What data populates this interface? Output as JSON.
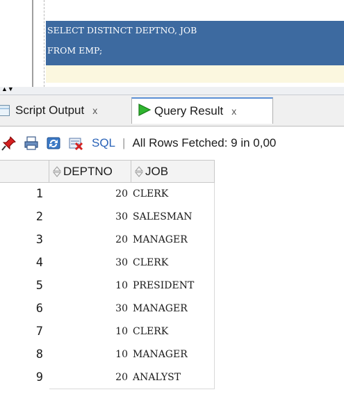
{
  "editor": {
    "lines": [
      "SELECT DISTINCT DEPTNO, JOB",
      "FROM EMP;"
    ]
  },
  "tabs": [
    {
      "label": "Script Output",
      "close": "x",
      "icon": "script-output-icon"
    },
    {
      "label": "Query Result",
      "close": "x",
      "icon": "run-icon"
    }
  ],
  "toolbar": {
    "sql_label": "SQL",
    "separator": "|",
    "status": "All Rows Fetched: 9 in 0,00"
  },
  "grid": {
    "columns": [
      "DEPTNO",
      "JOB"
    ],
    "rows": [
      {
        "num": "1",
        "deptno": "20",
        "job": "CLERK"
      },
      {
        "num": "2",
        "deptno": "30",
        "job": "SALESMAN"
      },
      {
        "num": "3",
        "deptno": "20",
        "job": "MANAGER"
      },
      {
        "num": "4",
        "deptno": "30",
        "job": "CLERK"
      },
      {
        "num": "5",
        "deptno": "10",
        "job": "PRESIDENT"
      },
      {
        "num": "6",
        "deptno": "30",
        "job": "MANAGER"
      },
      {
        "num": "7",
        "deptno": "10",
        "job": "CLERK"
      },
      {
        "num": "8",
        "deptno": "10",
        "job": "MANAGER"
      },
      {
        "num": "9",
        "deptno": "20",
        "job": "ANALYST"
      }
    ]
  },
  "colors": {
    "selection": "#3d6aa0",
    "current_line": "#fbf7df",
    "sql_link": "#2a63b8",
    "active_tab_accent": "#5a8fd4"
  }
}
